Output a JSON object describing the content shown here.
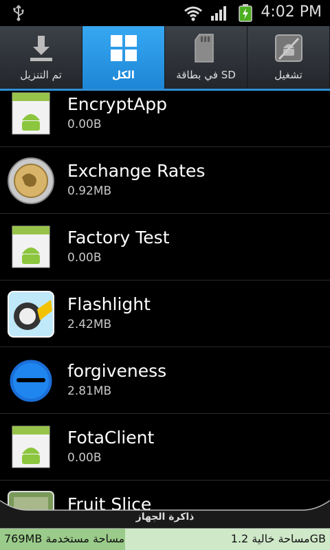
{
  "status_bar": {
    "time": "4:02 PM",
    "icons": [
      "usb-icon",
      "wifi-icon",
      "signal-icon",
      "battery-charging-icon"
    ]
  },
  "tabs": [
    {
      "label": "تم التنزيل",
      "icon": "download-icon",
      "active": false
    },
    {
      "label": "الكل",
      "icon": "grid-icon",
      "active": true
    },
    {
      "label": "في بطاقة SD",
      "icon": "sd-card-icon",
      "active": false
    },
    {
      "label": "تشغيل",
      "icon": "running-app-icon",
      "active": false
    }
  ],
  "apps": [
    {
      "name": "EncryptApp",
      "size": "0.00B",
      "icon": "android-default-icon"
    },
    {
      "name": "Exchange Rates",
      "size": "0.92MB",
      "icon": "coin-globe-icon"
    },
    {
      "name": "Factory Test",
      "size": "0.00B",
      "icon": "android-default-icon"
    },
    {
      "name": "Flashlight",
      "size": "2.42MB",
      "icon": "flashlight-icon"
    },
    {
      "name": "forgiveness",
      "size": "2.81MB",
      "icon": "forgiveness-icon"
    },
    {
      "name": "FotaClient",
      "size": "0.00B",
      "icon": "android-default-icon"
    },
    {
      "name": "Fruit Slice",
      "size": "",
      "icon": "fruit-slice-icon"
    }
  ],
  "storage": {
    "title": "ذاكرة الجهاز",
    "used": "769MB مساحة مستخدمة",
    "free": "مساحة خالية 1.2GB",
    "used_fraction": 0.38
  }
}
